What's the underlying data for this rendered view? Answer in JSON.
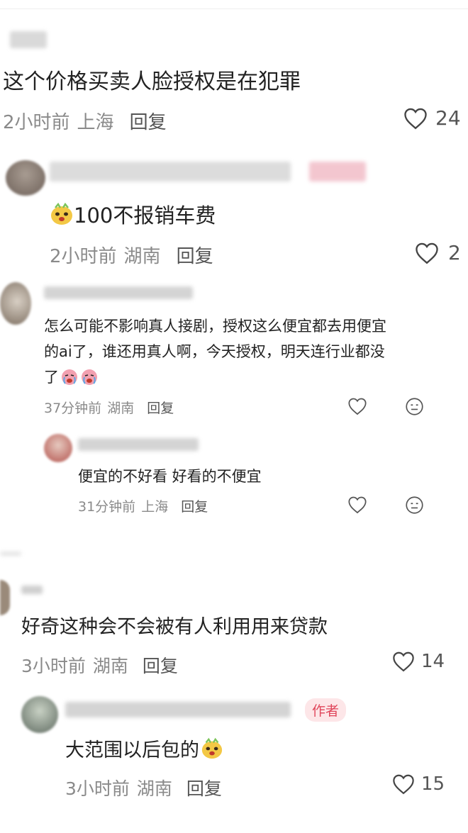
{
  "comments": [
    {
      "text": "这个价格买卖人脸授权是在犯罪",
      "time": "2小时前",
      "location": "上海",
      "reply_label": "回复",
      "likes": "24"
    },
    {
      "text": "100不报销车费",
      "emoji": "face-emoji",
      "time": "2小时前",
      "location": "湖南",
      "reply_label": "回复",
      "likes": "2"
    },
    {
      "text_line1": "怎么可能不影响真人接剧，授权这么便宜都去用便宜",
      "text_line2": "的ai了，谁还用真人啊，今天授权，明天连行业都没",
      "text_line3": "了",
      "emoji": "crying-face-emoji",
      "time": "37分钟前",
      "location": "湖南",
      "reply_label": "回复"
    },
    {
      "text": "便宜的不好看 好看的不便宜",
      "time": "31分钟前",
      "location": "上海",
      "reply_label": "回复"
    },
    {
      "text": "好奇这种会不会被有人利用用来贷款",
      "time": "3小时前",
      "location": "湖南",
      "reply_label": "回复",
      "likes": "14"
    },
    {
      "text": "大范围以后包的",
      "emoji": "face-emoji",
      "author_tag": "作者",
      "time": "3小时前",
      "location": "湖南",
      "reply_label": "回复",
      "likes": "15"
    }
  ],
  "colors": {
    "text": "#222222",
    "meta": "#8a8a8a",
    "author_tag_bg": "#fde6e8",
    "author_tag_text": "#e0455a"
  }
}
